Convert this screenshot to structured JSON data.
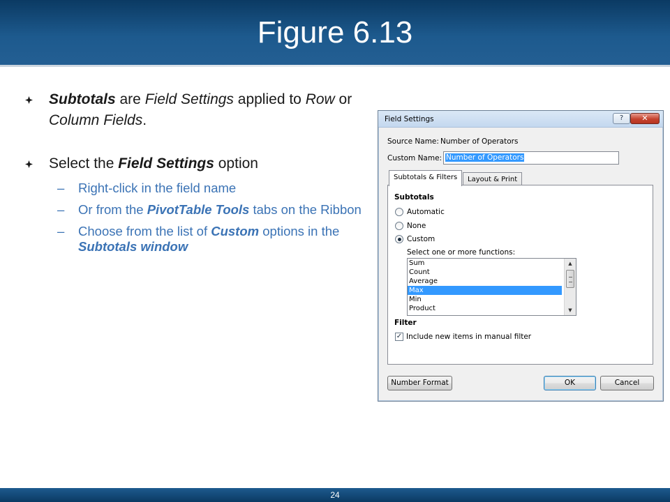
{
  "slide": {
    "title": "Figure 6.13",
    "page_number": "24"
  },
  "bullets": [
    {
      "parts": [
        {
          "text": "Subtotals",
          "style": "bi"
        },
        {
          "text": " are ",
          "style": "n"
        },
        {
          "text": "Field Settings",
          "style": "i"
        },
        {
          "text": " applied to ",
          "style": "n"
        },
        {
          "text": "Row",
          "style": "i"
        },
        {
          "text": " or ",
          "style": "n"
        },
        {
          "text": "Column Fields",
          "style": "i"
        },
        {
          "text": ".",
          "style": "n"
        }
      ],
      "subs": []
    },
    {
      "parts": [
        {
          "text": "Select the ",
          "style": "n"
        },
        {
          "text": "Field Settings",
          "style": "bi"
        },
        {
          "text": " option",
          "style": "n"
        }
      ],
      "subs": [
        [
          {
            "text": "Right-click in the field name",
            "style": "n"
          }
        ],
        [
          {
            "text": "Or from the ",
            "style": "n"
          },
          {
            "text": "PivotTable Tools",
            "style": "bi"
          },
          {
            "text": " tabs on the Ribbon",
            "style": "n"
          }
        ],
        [
          {
            "text": "Choose from the list of ",
            "style": "n"
          },
          {
            "text": "Custom",
            "style": "bi"
          },
          {
            "text": " options in the ",
            "style": "n"
          },
          {
            "text": "Subtotals window",
            "style": "bi"
          }
        ]
      ]
    }
  ],
  "sub_dash": "–",
  "dialog": {
    "title": "Field Settings",
    "help_label": "?",
    "close_label": "✕",
    "source_name_label": "Source Name:",
    "source_name_value": "Number of Operators",
    "custom_name_label": "Custom Name:",
    "custom_name_value": "Number of Operators",
    "tabs": [
      "Subtotals & Filters",
      "Layout & Print"
    ],
    "subtotals_heading": "Subtotals",
    "radio_options": [
      "Automatic",
      "None",
      "Custom"
    ],
    "selected_radio": "Custom",
    "functions_label": "Select one or more functions:",
    "functions": [
      "Sum",
      "Count",
      "Average",
      "Max",
      "Min",
      "Product"
    ],
    "selected_function": "Max",
    "filter_heading": "Filter",
    "filter_checkbox_label": "Include new items in manual filter",
    "filter_checked": true,
    "number_format_label": "Number Format",
    "ok_label": "OK",
    "cancel_label": "Cancel"
  },
  "colors": {
    "title_bar": "#1d5a8e",
    "sub_bullet_text": "#3b73b5",
    "selection": "#3399ff"
  }
}
